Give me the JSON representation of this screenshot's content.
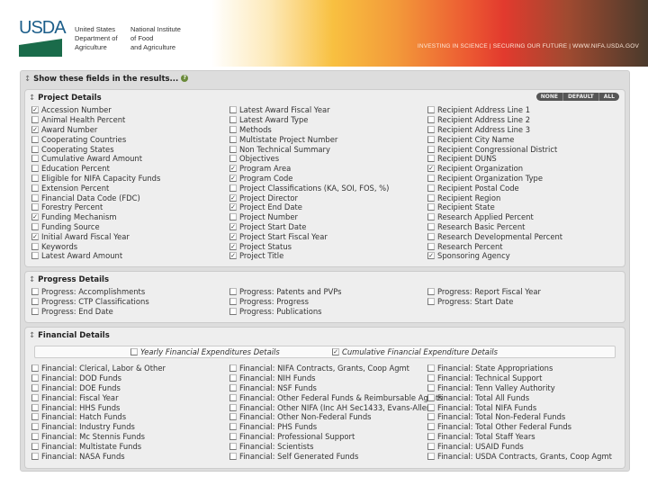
{
  "header": {
    "logo_text": "USDA",
    "dept": "United States\nDepartment of\nAgriculture",
    "institute": "National Institute\nof Food\nand Agriculture",
    "tagline": "INVESTING IN SCIENCE | SECURING OUR FUTURE | WWW.NIFA.USDA.GOV",
    "colors": {
      "brand_blue": "#1c5e8a",
      "brand_green": "#1a6b4a"
    }
  },
  "show_fields": {
    "title": "Show these fields in the results...",
    "help_icon": "?"
  },
  "project": {
    "title": "Project Details",
    "buttons": [
      "NONE",
      "DEFAULT",
      "ALL"
    ],
    "columns": [
      [
        {
          "label": "Accession Number",
          "checked": true
        },
        {
          "label": "Animal Health Percent",
          "checked": false
        },
        {
          "label": "Award Number",
          "checked": true
        },
        {
          "label": "Cooperating Countries",
          "checked": false
        },
        {
          "label": "Cooperating States",
          "checked": false
        },
        {
          "label": "Cumulative Award Amount",
          "checked": false
        },
        {
          "label": "Education Percent",
          "checked": false
        },
        {
          "label": "Eligible for NIFA Capacity Funds",
          "checked": false
        },
        {
          "label": "Extension Percent",
          "checked": false
        },
        {
          "label": "Financial Data Code (FDC)",
          "checked": false
        },
        {
          "label": "Forestry Percent",
          "checked": false
        },
        {
          "label": "Funding Mechanism",
          "checked": true
        },
        {
          "label": "Funding Source",
          "checked": false
        },
        {
          "label": "Initial Award Fiscal Year",
          "checked": true
        },
        {
          "label": "Keywords",
          "checked": false
        },
        {
          "label": "Latest Award Amount",
          "checked": false
        }
      ],
      [
        {
          "label": "Latest Award Fiscal Year",
          "checked": false
        },
        {
          "label": "Latest Award Type",
          "checked": false
        },
        {
          "label": "Methods",
          "checked": false
        },
        {
          "label": "Multistate Project Number",
          "checked": false
        },
        {
          "label": "Non Technical Summary",
          "checked": false
        },
        {
          "label": "Objectives",
          "checked": false
        },
        {
          "label": "Program Area",
          "checked": true
        },
        {
          "label": "Program Code",
          "checked": true
        },
        {
          "label": "Project Classifications (KA, SOI, FOS, %)",
          "checked": false
        },
        {
          "label": "Project Director",
          "checked": true
        },
        {
          "label": "Project End Date",
          "checked": true
        },
        {
          "label": "Project Number",
          "checked": false
        },
        {
          "label": "Project Start Date",
          "checked": true
        },
        {
          "label": "Project Start Fiscal Year",
          "checked": true
        },
        {
          "label": "Project Status",
          "checked": true
        },
        {
          "label": "Project Title",
          "checked": true
        }
      ],
      [
        {
          "label": "Recipient Address Line 1",
          "checked": false
        },
        {
          "label": "Recipient Address Line 2",
          "checked": false
        },
        {
          "label": "Recipient Address Line 3",
          "checked": false
        },
        {
          "label": "Recipient City Name",
          "checked": false
        },
        {
          "label": "Recipient Congressional District",
          "checked": false
        },
        {
          "label": "Recipient DUNS",
          "checked": false
        },
        {
          "label": "Recipient Organization",
          "checked": true
        },
        {
          "label": "Recipient Organization Type",
          "checked": false
        },
        {
          "label": "Recipient Postal Code",
          "checked": false
        },
        {
          "label": "Recipient Region",
          "checked": false
        },
        {
          "label": "Recipient State",
          "checked": false
        },
        {
          "label": "Research Applied Percent",
          "checked": false
        },
        {
          "label": "Research Basic Percent",
          "checked": false
        },
        {
          "label": "Research Developmental Percent",
          "checked": false
        },
        {
          "label": "Research Percent",
          "checked": false
        },
        {
          "label": "Sponsoring Agency",
          "checked": true
        }
      ]
    ]
  },
  "progress": {
    "title": "Progress Details",
    "columns": [
      [
        {
          "label": "Progress: Accomplishments",
          "checked": false
        },
        {
          "label": "Progress: CTP Classifications",
          "checked": false
        },
        {
          "label": "Progress: End Date",
          "checked": false
        }
      ],
      [
        {
          "label": "Progress: Patents and PVPs",
          "checked": false
        },
        {
          "label": "Progress: Progress",
          "checked": false
        },
        {
          "label": "Progress: Publications",
          "checked": false
        }
      ],
      [
        {
          "label": "Progress: Report Fiscal Year",
          "checked": false
        },
        {
          "label": "Progress: Start Date",
          "checked": false
        }
      ]
    ]
  },
  "financial": {
    "title": "Financial Details",
    "yearly": {
      "label": "Yearly Financial Expenditures Details",
      "checked": false
    },
    "cumulative": {
      "label": "Cumulative Financial Expenditure Details",
      "checked": true
    },
    "columns": [
      [
        {
          "label": "Financial: Clerical, Labor & Other",
          "checked": false
        },
        {
          "label": "Financial: DOD Funds",
          "checked": false
        },
        {
          "label": "Financial: DOE Funds",
          "checked": false
        },
        {
          "label": "Financial: Fiscal Year",
          "checked": false
        },
        {
          "label": "Financial: HHS Funds",
          "checked": false
        },
        {
          "label": "Financial: Hatch Funds",
          "checked": false
        },
        {
          "label": "Financial: Industry Funds",
          "checked": false
        },
        {
          "label": "Financial: Mc Stennis Funds",
          "checked": false
        },
        {
          "label": "Financial: Multistate Funds",
          "checked": false
        },
        {
          "label": "Financial: NASA Funds",
          "checked": false
        }
      ],
      [
        {
          "label": "Financial: NIFA Contracts, Grants, Coop Agmt",
          "checked": false
        },
        {
          "label": "Financial: NIH Funds",
          "checked": false
        },
        {
          "label": "Financial: NSF Funds",
          "checked": false
        },
        {
          "label": "Financial: Other Federal Funds & Reimbursable Agmts",
          "checked": false
        },
        {
          "label": "Financial: Other NIFA (Inc AH Sec1433, Evans-Allen)",
          "checked": false
        },
        {
          "label": "Financial: Other Non-Federal Funds",
          "checked": false
        },
        {
          "label": "Financial: PHS Funds",
          "checked": false
        },
        {
          "label": "Financial: Professional Support",
          "checked": false
        },
        {
          "label": "Financial: Scientists",
          "checked": false
        },
        {
          "label": "Financial: Self Generated Funds",
          "checked": false
        }
      ],
      [
        {
          "label": "Financial: State Appropriations",
          "checked": false
        },
        {
          "label": "Financial: Technical Support",
          "checked": false
        },
        {
          "label": "Financial: Tenn Valley Authority",
          "checked": false
        },
        {
          "label": "Financial: Total All Funds",
          "checked": false
        },
        {
          "label": "Financial: Total NIFA Funds",
          "checked": false
        },
        {
          "label": "Financial: Total Non-Federal Funds",
          "checked": false
        },
        {
          "label": "Financial: Total Other Federal Funds",
          "checked": false
        },
        {
          "label": "Financial: Total Staff Years",
          "checked": false
        },
        {
          "label": "Financial: USAID Funds",
          "checked": false
        },
        {
          "label": "Financial: USDA Contracts, Grants, Coop Agmt",
          "checked": false
        }
      ]
    ]
  }
}
